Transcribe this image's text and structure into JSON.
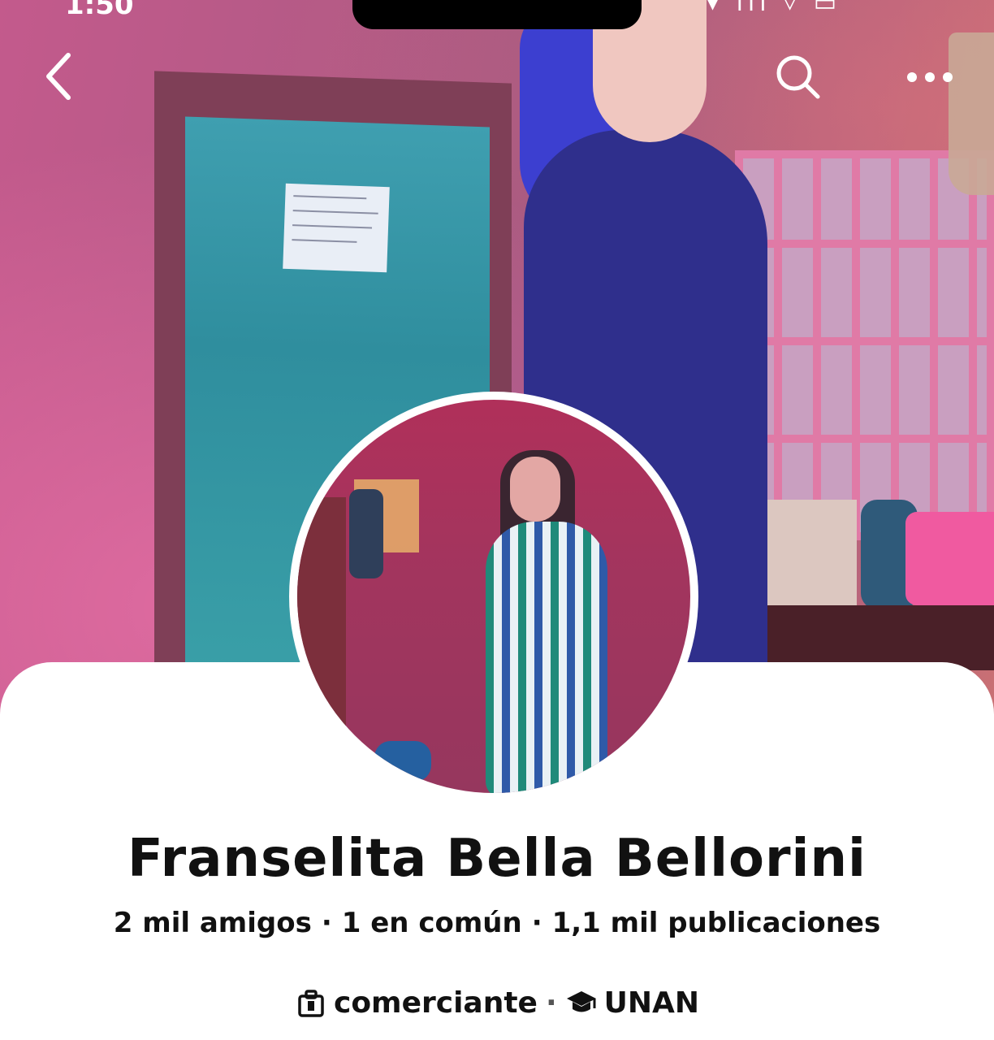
{
  "status_bar": {
    "time": "1:50",
    "right_indicators": "▾ ıll ▿ ▭"
  },
  "nav": {
    "back_icon": "chevron-left-icon",
    "search_icon": "search-icon",
    "more_icon": "more-horizontal-icon"
  },
  "profile": {
    "name": "Franselita Bella Bellorini",
    "stats": {
      "friends": "2 mil amigos",
      "mutual": "1 en común",
      "posts": "1,1 mil publicaciones",
      "separator": "·"
    },
    "details": {
      "work_icon": "briefcase-icon",
      "work": "comerciante",
      "separator": "·",
      "education_icon": "graduation-cap-icon",
      "education": "UNAN"
    }
  },
  "colors": {
    "text": "#111111",
    "panel_bg": "#ffffff",
    "nav_icon": "#ffffff"
  }
}
